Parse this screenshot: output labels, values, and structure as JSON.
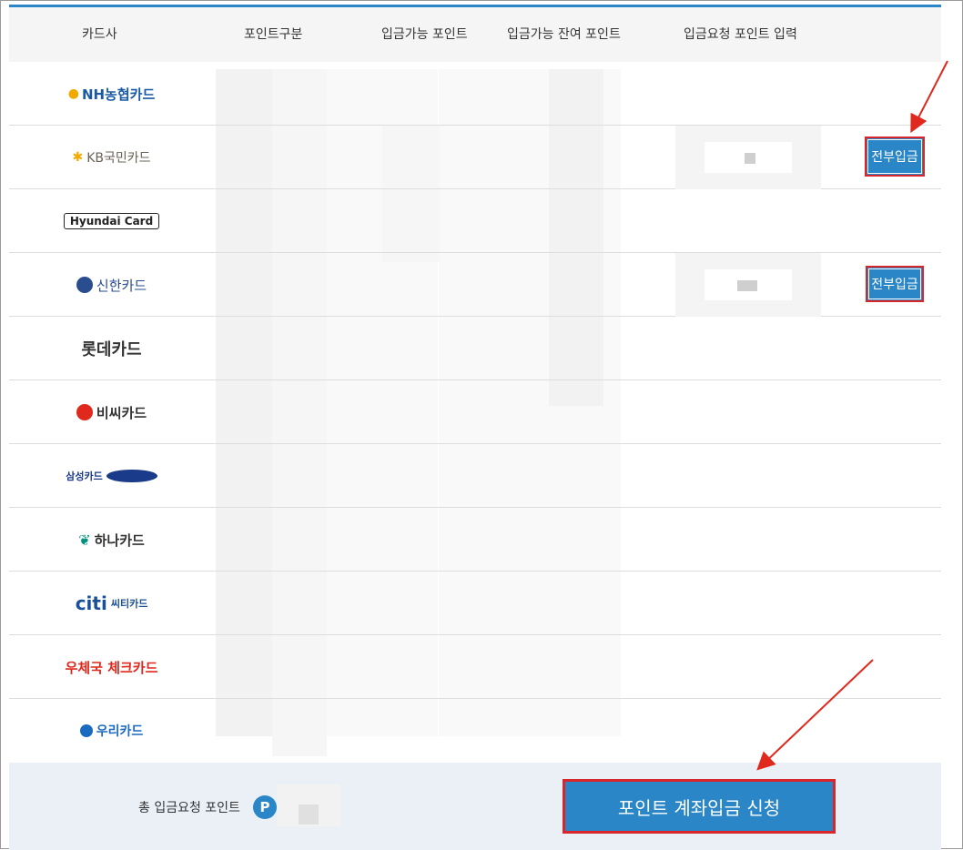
{
  "table": {
    "headers": {
      "card_company": "카드사",
      "point_type": "포인트구분",
      "available_points": "입금가능 포인트",
      "available_remaining": "입금가능 잔여 포인트",
      "request_input": "입금요청 포인트 입력"
    },
    "cards": [
      {
        "name": "NH농협카드",
        "color": "#1a5aa5"
      },
      {
        "name": "KB국민카드",
        "color": "#6b6255"
      },
      {
        "name": "Hyundai Card",
        "color": "#222222"
      },
      {
        "name": "신한카드",
        "color": "#2a4d8f"
      },
      {
        "name": "롯데카드",
        "color": "#333333"
      },
      {
        "name": "비씨카드",
        "color": "#333333"
      },
      {
        "name": "삼성카드",
        "color": "#1a3a8a"
      },
      {
        "name": "하나카드",
        "color": "#333333"
      },
      {
        "name": "씨티카드",
        "color": "#1a4f9a"
      },
      {
        "name": "우체국 체크카드",
        "color": "#e0281d"
      },
      {
        "name": "우리카드",
        "color": "#1a6abf"
      }
    ],
    "deposit_all_label": "전부입금"
  },
  "footer": {
    "total_label": "총 입금요청 포인트",
    "point_badge": "P",
    "apply_button_label": "포인트 계좌입금 신청"
  },
  "colors": {
    "accent": "#2a86c6",
    "highlight_border": "#d9262b"
  }
}
